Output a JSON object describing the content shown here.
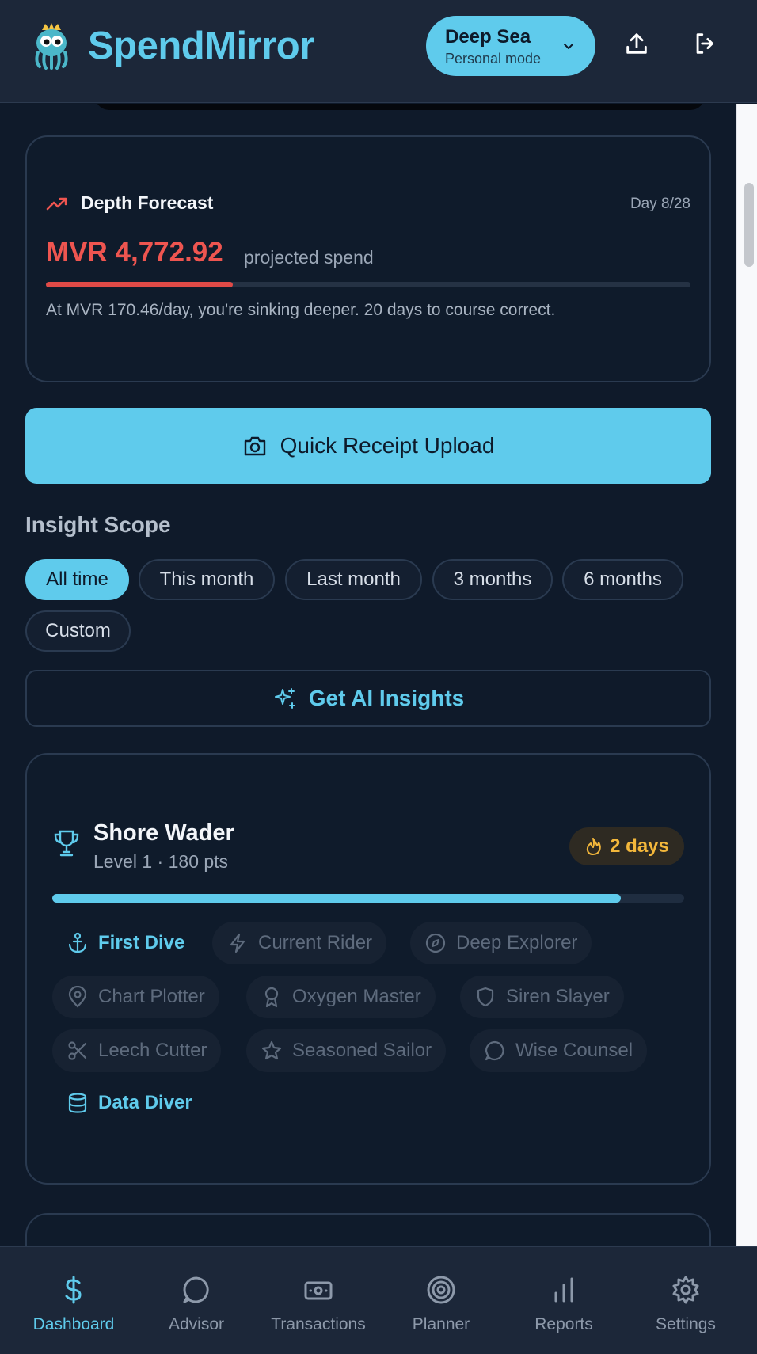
{
  "app": {
    "brand": "SpendMirror",
    "mode": {
      "title": "Deep Sea",
      "subtitle": "Personal mode"
    }
  },
  "forecast": {
    "title": "Depth Forecast",
    "day": "Day 8/28",
    "amount": "MVR 4,772.92",
    "amount_suffix": "projected spend",
    "progress_fraction": 0.29,
    "message": "At MVR 170.46/day, you're sinking deeper. 20 days to course correct."
  },
  "upload": {
    "label": "Quick Receipt Upload"
  },
  "insight_scope": {
    "title": "Insight Scope",
    "options": [
      "All time",
      "This month",
      "Last month",
      "3 months",
      "6 months",
      "Custom"
    ],
    "selected": "All time"
  },
  "ai": {
    "label": "Get AI Insights"
  },
  "achievements": {
    "title": "Shore Wader",
    "subtitle": "Level 1 · 180 pts",
    "streak": "2 days",
    "progress_fraction": 0.9,
    "badges": [
      {
        "label": "First Dive",
        "icon": "anchor-icon",
        "unlocked": true
      },
      {
        "label": "Current Rider",
        "icon": "lightning-icon",
        "unlocked": false
      },
      {
        "label": "Deep Explorer",
        "icon": "compass-icon",
        "unlocked": false
      },
      {
        "label": "Chart Plotter",
        "icon": "map-pin-icon",
        "unlocked": false
      },
      {
        "label": "Oxygen Master",
        "icon": "award-icon",
        "unlocked": false
      },
      {
        "label": "Siren Slayer",
        "icon": "shield-icon",
        "unlocked": false
      },
      {
        "label": "Leech Cutter",
        "icon": "scissors-icon",
        "unlocked": false
      },
      {
        "label": "Seasoned Sailor",
        "icon": "star-icon",
        "unlocked": false
      },
      {
        "label": "Wise Counsel",
        "icon": "chat-icon",
        "unlocked": false
      },
      {
        "label": "Data Diver",
        "icon": "database-icon",
        "unlocked": true
      }
    ]
  },
  "nav": {
    "items": [
      "Dashboard",
      "Advisor",
      "Transactions",
      "Planner",
      "Reports",
      "Settings"
    ],
    "active": "Dashboard"
  },
  "colors": {
    "accent": "#5fcbec",
    "danger": "#ee5550",
    "streak": "#f3b73b",
    "background": "#0f1a2a"
  }
}
